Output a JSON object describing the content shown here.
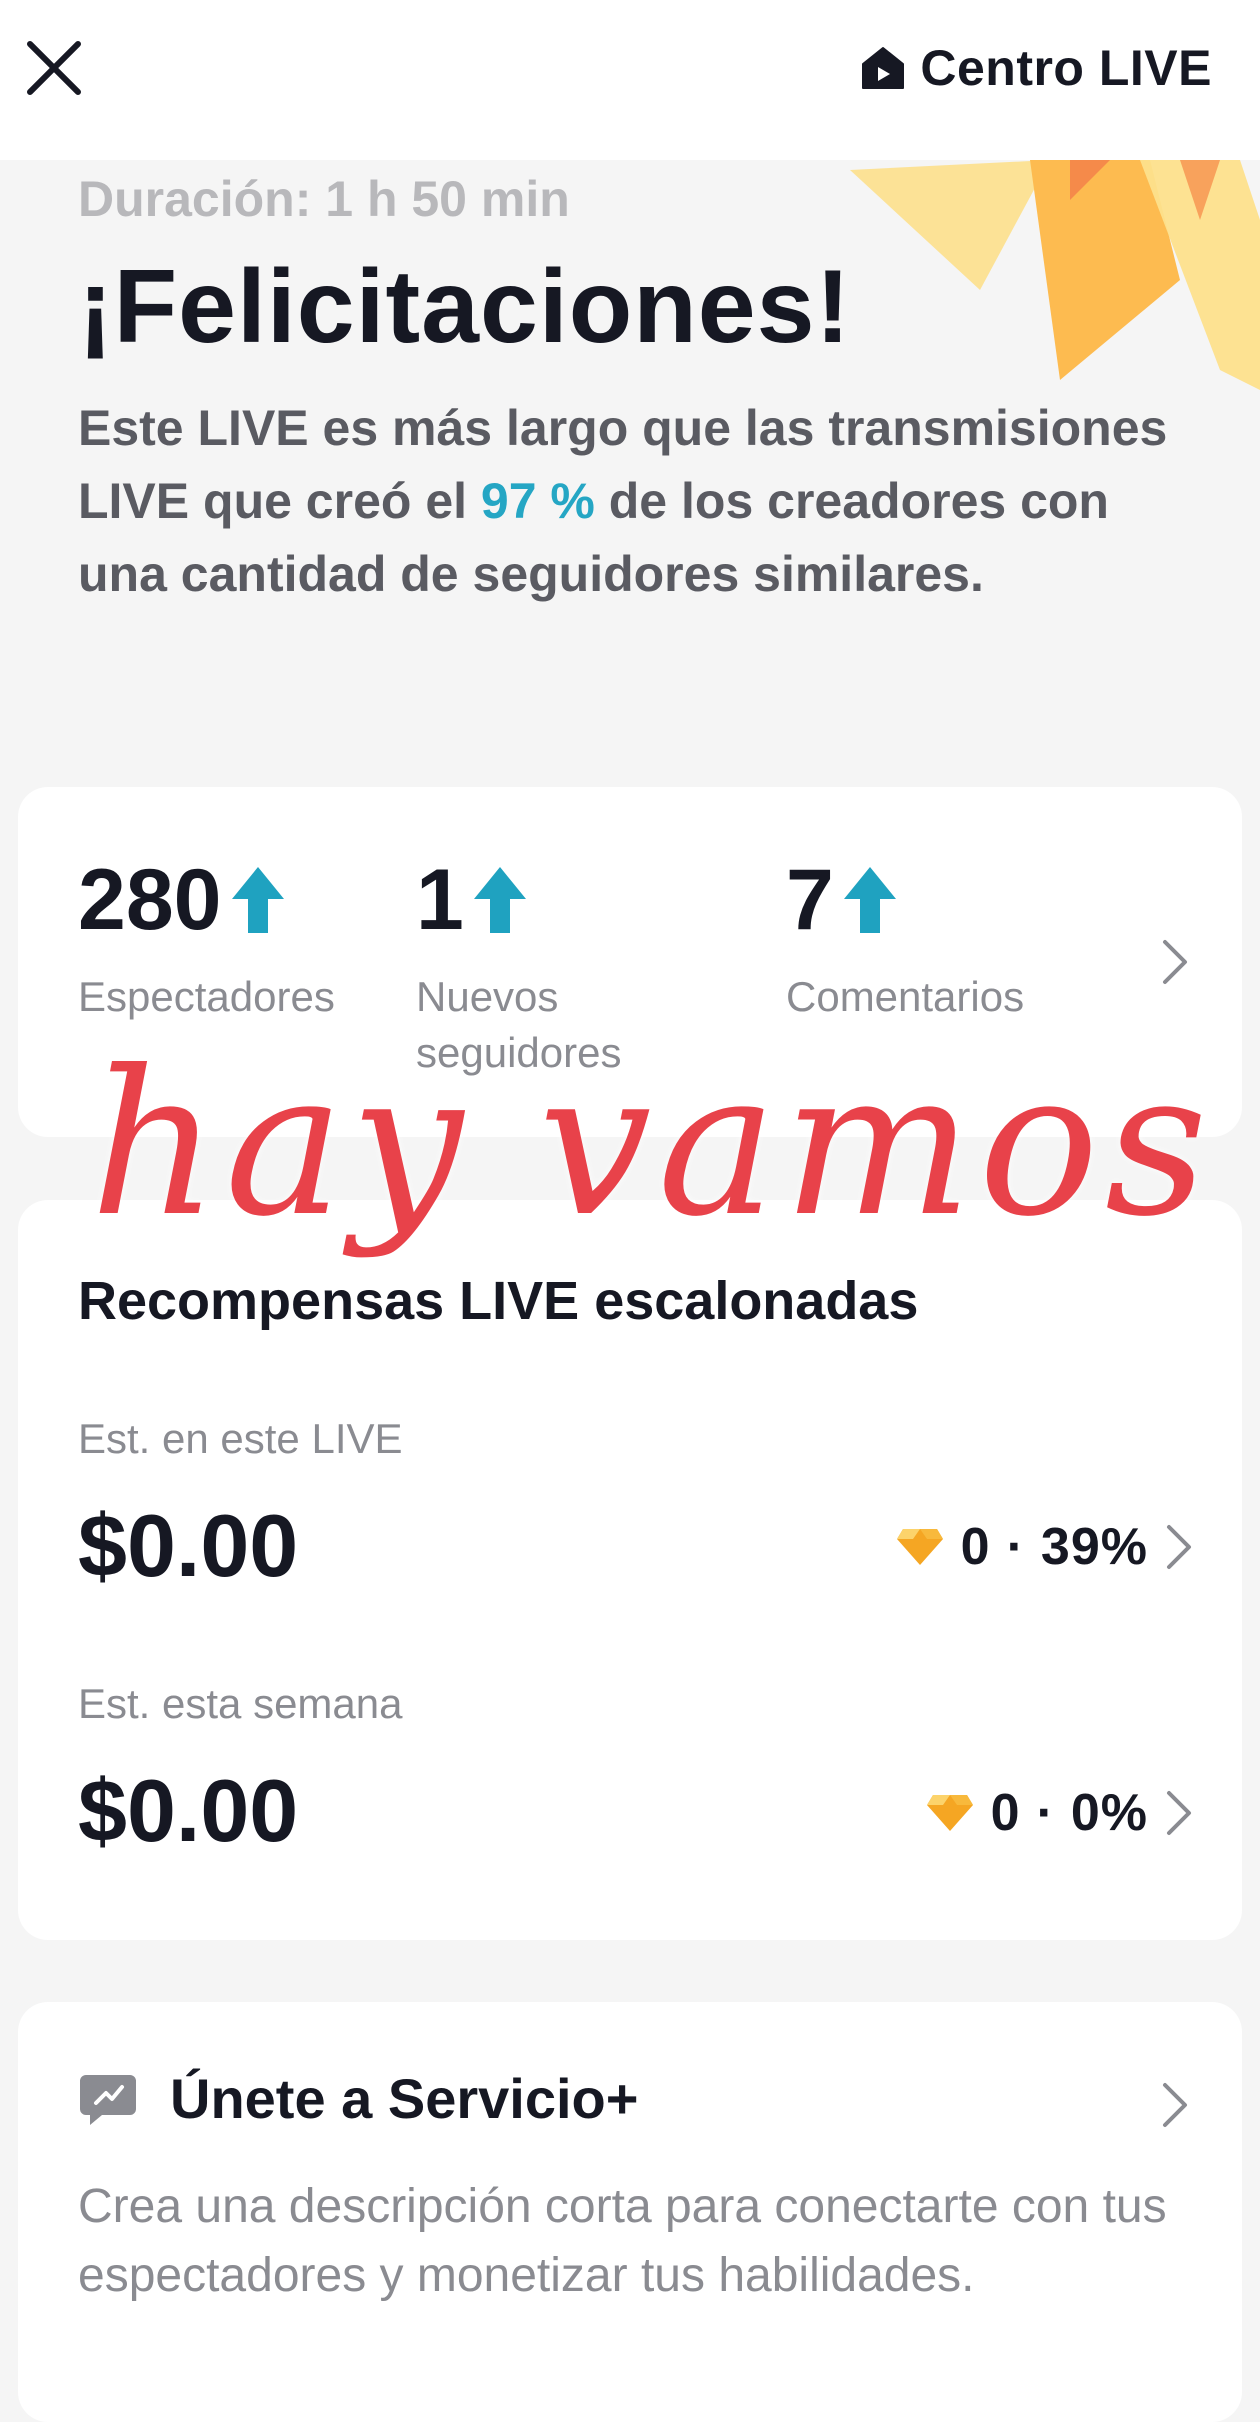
{
  "topbar": {
    "close_icon": "close-icon",
    "centro_icon": "live-house-icon",
    "centro_label": "Centro LIVE"
  },
  "hero": {
    "duration": "Duración: 1 h 50 min",
    "title": "¡Felicitaciones!",
    "desc_before": "Este LIVE es más largo que las transmisiones LIVE que creó el ",
    "desc_pct": "97 %",
    "desc_after": " de los creadores con una cantidad de seguidores similares."
  },
  "stats": [
    {
      "value": "280",
      "label": "Espectadores",
      "trend_icon": "arrow-up-icon"
    },
    {
      "value": "1",
      "label": "Nuevos seguidores",
      "trend_icon": "arrow-up-icon"
    },
    {
      "value": "7",
      "label": "Comentarios",
      "trend_icon": "arrow-up-icon"
    }
  ],
  "overlay_text": "hay vamos",
  "rewards": {
    "title": "Recompensas LIVE escalonadas",
    "rows": [
      {
        "label": "Est. en este LIVE",
        "amount": "$0.00",
        "diamonds": "0",
        "percent": "39%"
      },
      {
        "label": "Est. esta semana",
        "amount": "$0.00",
        "diamonds": "0",
        "percent": "0%"
      }
    ]
  },
  "service": {
    "icon": "service-plus-icon",
    "title": "Únete a Servicio+",
    "desc": "Crea una descripción corta para conectarte con tus espectadores y monetizar tus habilidades."
  },
  "colors": {
    "accent_teal": "#25a6c4",
    "handwriting_red": "#e8424a",
    "diamond_orange": "#f5a623"
  }
}
